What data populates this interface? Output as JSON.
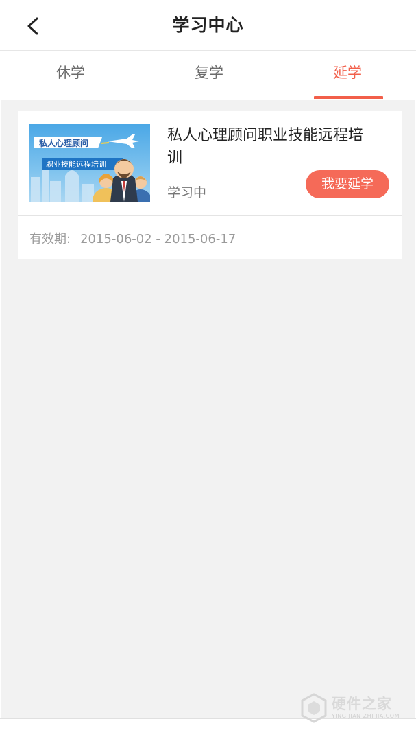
{
  "header": {
    "title": "学习中心"
  },
  "tabs": [
    {
      "label": "休学",
      "active": false
    },
    {
      "label": "复学",
      "active": false
    },
    {
      "label": "延学",
      "active": true
    }
  ],
  "accent_color": "#f25f4a",
  "course": {
    "thumbnail": {
      "line1": "私人心理顾问",
      "line2": "职业技能远程培训"
    },
    "title": "私人心理顾问职业技能远程培训",
    "status": "学习中",
    "action_label": "我要延学",
    "validity_label": "有效期:",
    "validity_range": "2015-06-02 - 2015-06-17"
  },
  "watermark": {
    "text": "硬件之家",
    "sub": "YING JIAN ZHI JIA.COM"
  }
}
